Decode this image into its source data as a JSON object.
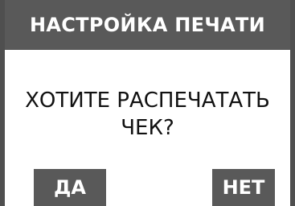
{
  "dialog": {
    "title": "НАСТРОЙКА ПЕЧАТИ",
    "message_line1": "ХОТИТЕ РАСПЕЧАТАТЬ",
    "message_line2": "ЧЕК?",
    "yes_label": "ДА",
    "no_label": "НЕТ"
  },
  "colors": {
    "header_background": "#595959",
    "button_background": "#595959",
    "text_on_dark": "#ffffff",
    "background": "#ffffff"
  }
}
